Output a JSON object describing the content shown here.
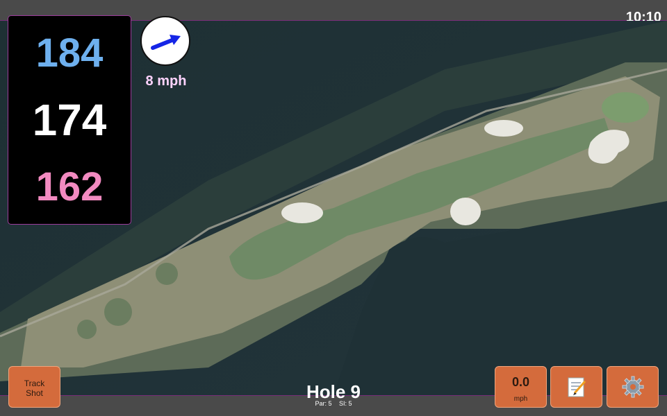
{
  "status": {
    "time": "10:10"
  },
  "distances": {
    "back": "184",
    "middle": "174",
    "front": "162"
  },
  "wind": {
    "speed": "8 mph",
    "icon": "wind-arrow-icon"
  },
  "hole": {
    "title": "Hole 9",
    "par": "Par: 5",
    "si": "SI: 5"
  },
  "buttons": {
    "track_shot": "Track\nShot",
    "speed_value": "0.0",
    "speed_unit": "mph",
    "notes_icon": "notepad-icon",
    "settings_icon": "gear-icon"
  },
  "colors": {
    "back": "#6eb0ee",
    "middle": "#ffffff",
    "front": "#f28ac0",
    "button": "#d46b3c",
    "bar": "#4a4a4a",
    "accent": "#9c3c9c"
  }
}
